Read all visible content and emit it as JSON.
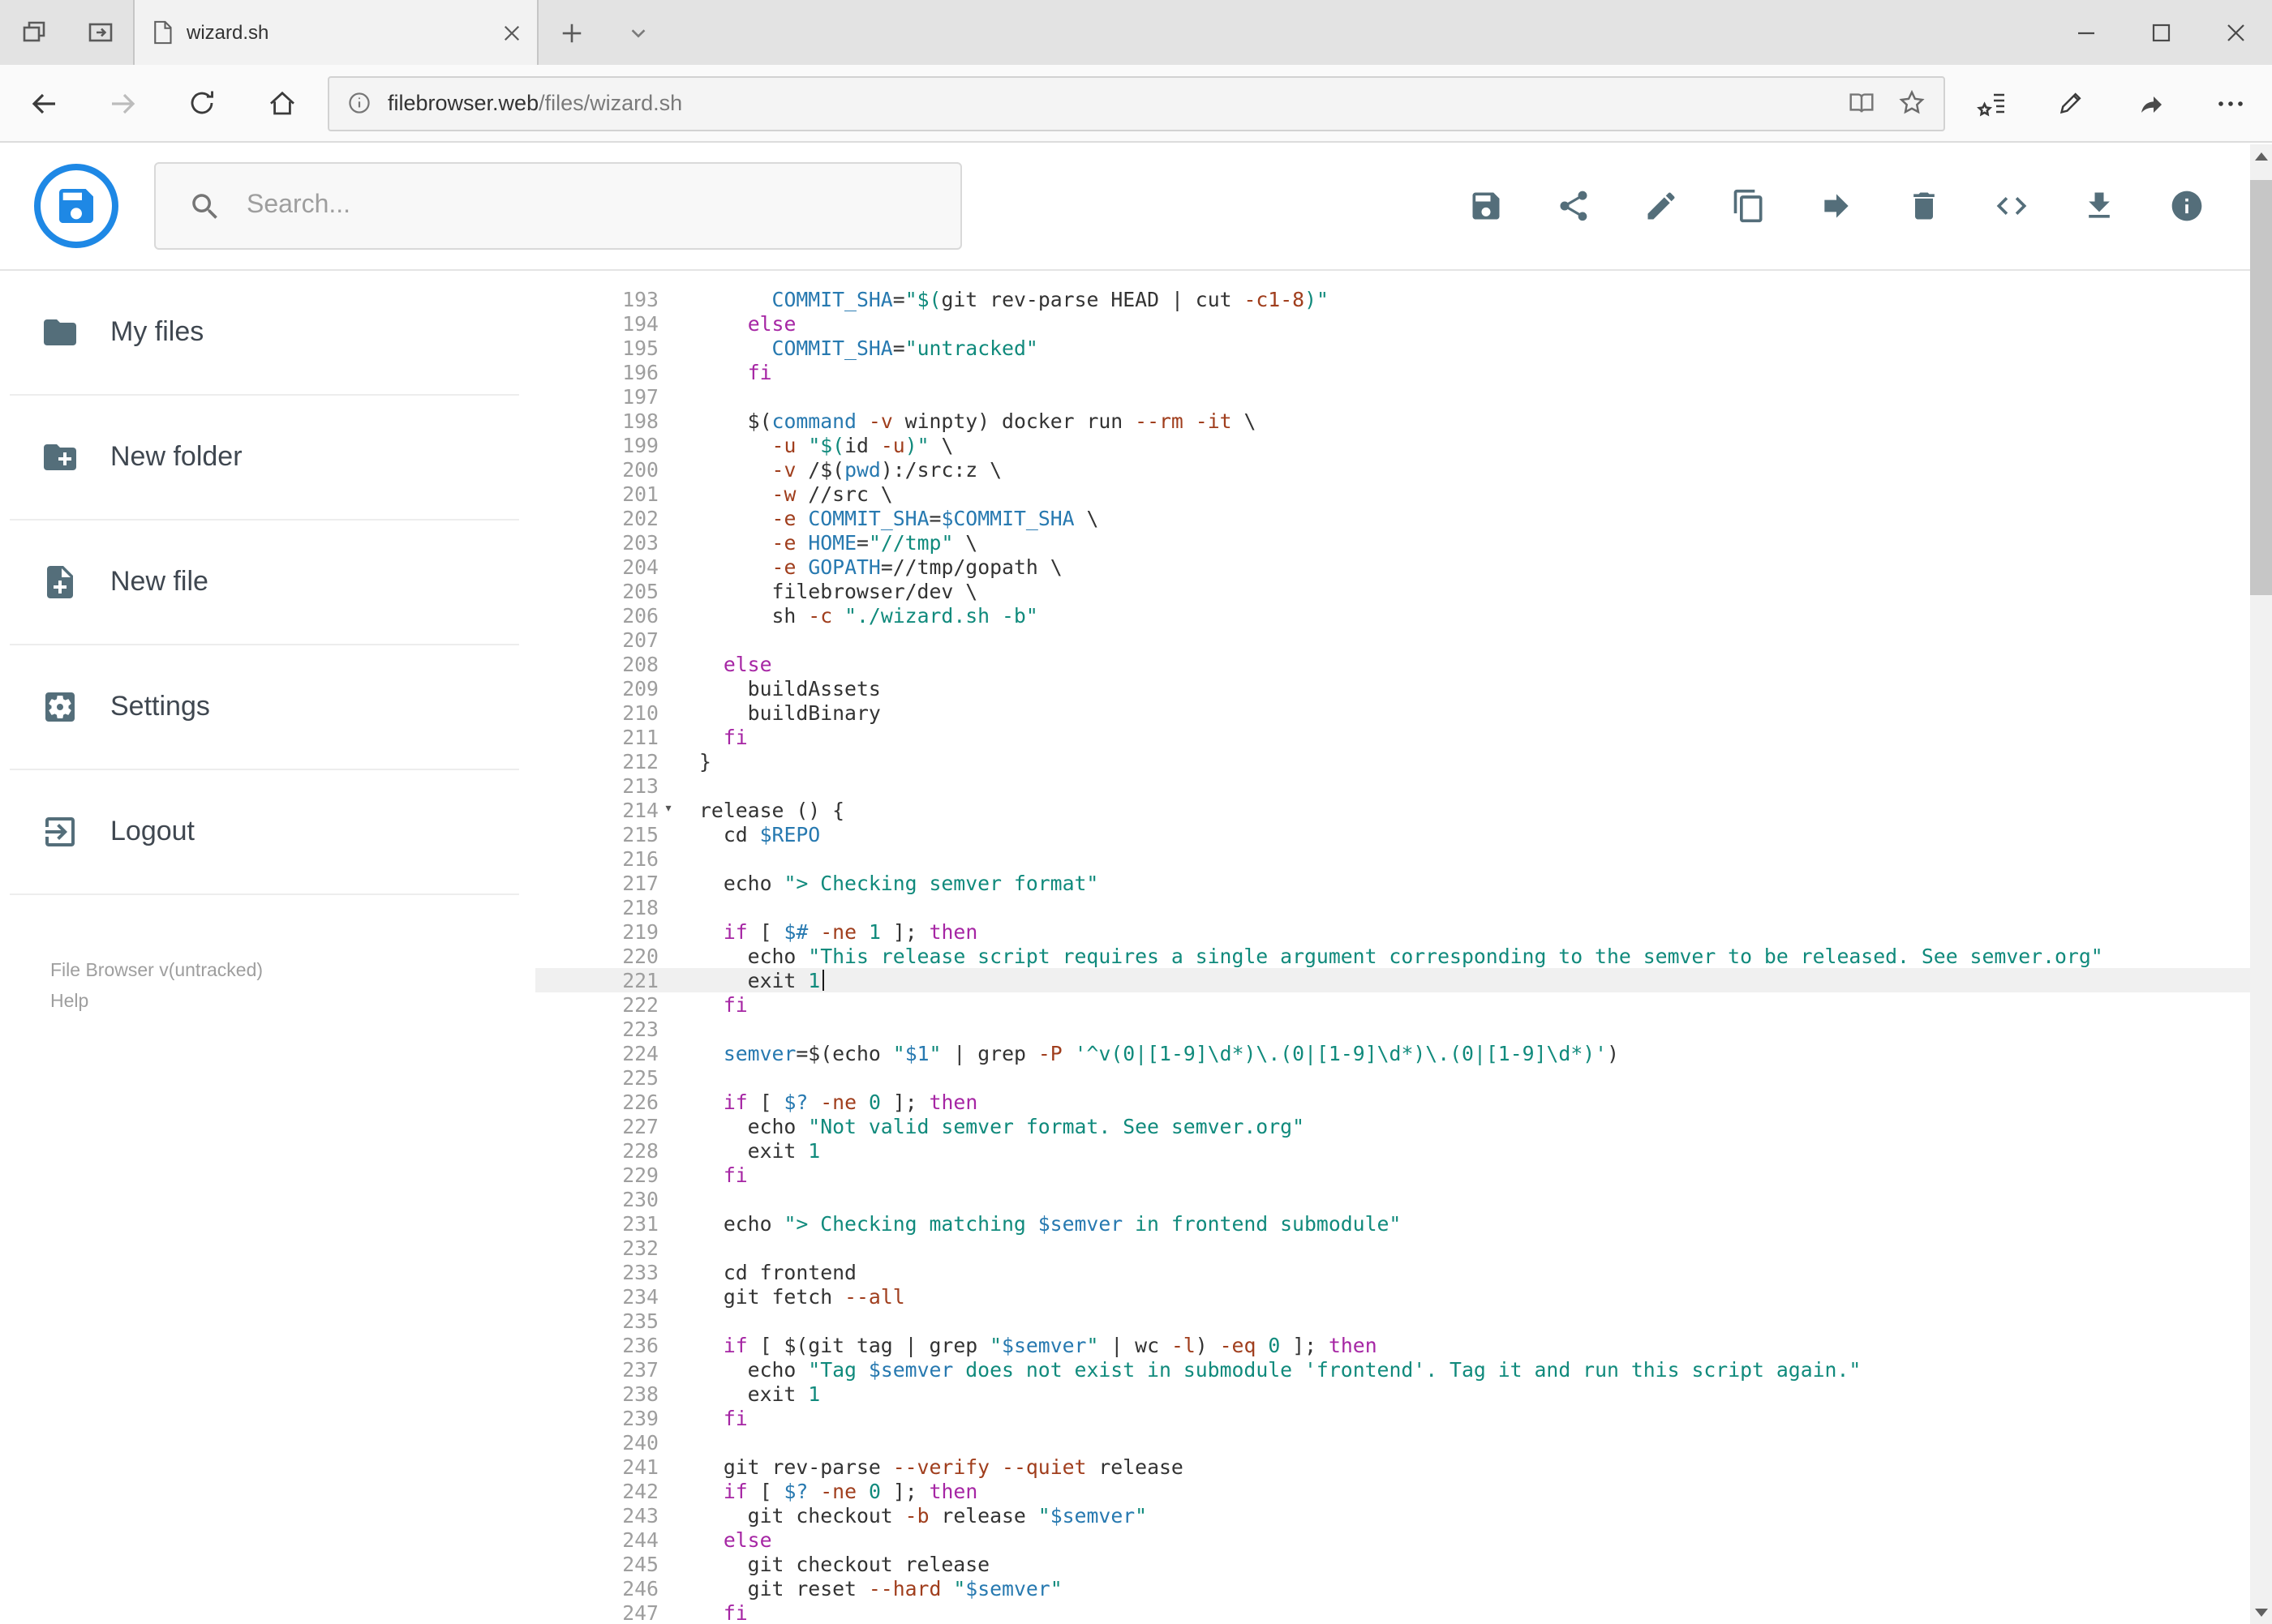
{
  "browser": {
    "tab_title": "wizard.sh",
    "url_host": "filebrowser.web",
    "url_path": "/files/wizard.sh"
  },
  "header": {
    "search_placeholder": "Search...",
    "toolbar": [
      {
        "id": "save",
        "icon": "save"
      },
      {
        "id": "share",
        "icon": "share"
      },
      {
        "id": "edit",
        "icon": "edit"
      },
      {
        "id": "copy",
        "icon": "copy"
      },
      {
        "id": "move",
        "icon": "move"
      },
      {
        "id": "delete",
        "icon": "delete"
      },
      {
        "id": "code",
        "icon": "code"
      },
      {
        "id": "download",
        "icon": "download"
      },
      {
        "id": "info",
        "icon": "info"
      }
    ]
  },
  "sidebar": {
    "items": [
      {
        "id": "my-files",
        "label": "My files",
        "icon": "folder"
      },
      {
        "id": "new-folder",
        "label": "New folder",
        "icon": "create-new-folder"
      },
      {
        "id": "new-file",
        "label": "New file",
        "icon": "note-add"
      },
      {
        "id": "settings",
        "label": "Settings",
        "icon": "settings"
      },
      {
        "id": "logout",
        "label": "Logout",
        "icon": "logout"
      }
    ],
    "footer_version": "File Browser v(untracked)",
    "footer_help": "Help"
  },
  "editor": {
    "active_line": 221,
    "lines": [
      {
        "n": 193,
        "t": [
          [
            "p",
            "      "
          ],
          [
            "v",
            "COMMIT_SHA"
          ],
          [
            "p",
            "="
          ],
          [
            "s",
            "\"$("
          ],
          [
            "p",
            "git rev-parse HEAD | cut "
          ],
          [
            "f",
            "-c1-8"
          ],
          [
            "s",
            ")\""
          ]
        ]
      },
      {
        "n": 194,
        "t": [
          [
            "p",
            "    "
          ],
          [
            "k",
            "else"
          ]
        ]
      },
      {
        "n": 195,
        "t": [
          [
            "p",
            "      "
          ],
          [
            "v",
            "COMMIT_SHA"
          ],
          [
            "p",
            "="
          ],
          [
            "s",
            "\"untracked\""
          ]
        ]
      },
      {
        "n": 196,
        "t": [
          [
            "p",
            "    "
          ],
          [
            "k",
            "fi"
          ]
        ]
      },
      {
        "n": 197,
        "t": []
      },
      {
        "n": 198,
        "t": [
          [
            "p",
            "    $("
          ],
          [
            "v",
            "command"
          ],
          [
            "p",
            " "
          ],
          [
            "f",
            "-v"
          ],
          [
            "p",
            " winpty) docker run "
          ],
          [
            "f",
            "--rm"
          ],
          [
            "p",
            " "
          ],
          [
            "f",
            "-it"
          ],
          [
            "p",
            " \\"
          ]
        ]
      },
      {
        "n": 199,
        "t": [
          [
            "p",
            "      "
          ],
          [
            "f",
            "-u"
          ],
          [
            "p",
            " "
          ],
          [
            "s",
            "\"$("
          ],
          [
            "p",
            "id "
          ],
          [
            "f",
            "-u"
          ],
          [
            "s",
            ")\""
          ],
          [
            "p",
            " \\"
          ]
        ]
      },
      {
        "n": 200,
        "t": [
          [
            "p",
            "      "
          ],
          [
            "f",
            "-v"
          ],
          [
            "p",
            " /$("
          ],
          [
            "v",
            "pwd"
          ],
          [
            "p",
            "):/src:z \\"
          ]
        ]
      },
      {
        "n": 201,
        "t": [
          [
            "p",
            "      "
          ],
          [
            "f",
            "-w"
          ],
          [
            "p",
            " //src \\"
          ]
        ]
      },
      {
        "n": 202,
        "t": [
          [
            "p",
            "      "
          ],
          [
            "f",
            "-e"
          ],
          [
            "p",
            " "
          ],
          [
            "v",
            "COMMIT_SHA"
          ],
          [
            "p",
            "="
          ],
          [
            "v",
            "$COMMIT_SHA"
          ],
          [
            "p",
            " \\"
          ]
        ]
      },
      {
        "n": 203,
        "t": [
          [
            "p",
            "      "
          ],
          [
            "f",
            "-e"
          ],
          [
            "p",
            " "
          ],
          [
            "v",
            "HOME"
          ],
          [
            "p",
            "="
          ],
          [
            "s",
            "\"//tmp\""
          ],
          [
            "p",
            " \\"
          ]
        ]
      },
      {
        "n": 204,
        "t": [
          [
            "p",
            "      "
          ],
          [
            "f",
            "-e"
          ],
          [
            "p",
            " "
          ],
          [
            "v",
            "GOPATH"
          ],
          [
            "p",
            "=//tmp/gopath \\"
          ]
        ]
      },
      {
        "n": 205,
        "t": [
          [
            "p",
            "      filebrowser/dev \\"
          ]
        ]
      },
      {
        "n": 206,
        "t": [
          [
            "p",
            "      sh "
          ],
          [
            "f",
            "-c"
          ],
          [
            "p",
            " "
          ],
          [
            "s",
            "\"./wizard.sh -b\""
          ]
        ]
      },
      {
        "n": 207,
        "t": []
      },
      {
        "n": 208,
        "t": [
          [
            "p",
            "  "
          ],
          [
            "k",
            "else"
          ]
        ]
      },
      {
        "n": 209,
        "t": [
          [
            "p",
            "    buildAssets"
          ]
        ]
      },
      {
        "n": 210,
        "t": [
          [
            "p",
            "    buildBinary"
          ]
        ]
      },
      {
        "n": 211,
        "t": [
          [
            "p",
            "  "
          ],
          [
            "k",
            "fi"
          ]
        ]
      },
      {
        "n": 212,
        "t": [
          [
            "p",
            "}"
          ]
        ]
      },
      {
        "n": 213,
        "t": []
      },
      {
        "n": 214,
        "fold": true,
        "t": [
          [
            "p",
            "release () {"
          ]
        ]
      },
      {
        "n": 215,
        "t": [
          [
            "p",
            "  cd "
          ],
          [
            "v",
            "$REPO"
          ]
        ]
      },
      {
        "n": 216,
        "t": []
      },
      {
        "n": 217,
        "t": [
          [
            "p",
            "  echo "
          ],
          [
            "s",
            "\"> Checking semver format\""
          ]
        ]
      },
      {
        "n": 218,
        "t": []
      },
      {
        "n": 219,
        "t": [
          [
            "p",
            "  "
          ],
          [
            "k",
            "if"
          ],
          [
            "p",
            " [ "
          ],
          [
            "v",
            "$#"
          ],
          [
            "p",
            " "
          ],
          [
            "f",
            "-ne"
          ],
          [
            "p",
            " "
          ],
          [
            "d",
            "1"
          ],
          [
            "p",
            " ]; "
          ],
          [
            "k",
            "then"
          ]
        ]
      },
      {
        "n": 220,
        "t": [
          [
            "p",
            "    echo "
          ],
          [
            "s",
            "\"This release script requires a single argument corresponding to the semver to be released. See semver.org\""
          ]
        ]
      },
      {
        "n": 221,
        "t": [
          [
            "p",
            "    exit "
          ],
          [
            "d",
            "1"
          ],
          [
            "x",
            ""
          ]
        ]
      },
      {
        "n": 222,
        "t": [
          [
            "p",
            "  "
          ],
          [
            "k",
            "fi"
          ]
        ]
      },
      {
        "n": 223,
        "t": []
      },
      {
        "n": 224,
        "t": [
          [
            "p",
            "  "
          ],
          [
            "v",
            "semver"
          ],
          [
            "p",
            "=$(echo "
          ],
          [
            "s",
            "\""
          ],
          [
            "v",
            "$1"
          ],
          [
            "s",
            "\""
          ],
          [
            "p",
            " | grep "
          ],
          [
            "f",
            "-P"
          ],
          [
            "p",
            " "
          ],
          [
            "s",
            "'^v(0|[1-9]\\d*)\\.(0|[1-9]\\d*)\\.(0|[1-9]\\d*)'"
          ],
          [
            "p",
            ")"
          ]
        ]
      },
      {
        "n": 225,
        "t": []
      },
      {
        "n": 226,
        "t": [
          [
            "p",
            "  "
          ],
          [
            "k",
            "if"
          ],
          [
            "p",
            " [ "
          ],
          [
            "v",
            "$?"
          ],
          [
            "p",
            " "
          ],
          [
            "f",
            "-ne"
          ],
          [
            "p",
            " "
          ],
          [
            "d",
            "0"
          ],
          [
            "p",
            " ]; "
          ],
          [
            "k",
            "then"
          ]
        ]
      },
      {
        "n": 227,
        "t": [
          [
            "p",
            "    echo "
          ],
          [
            "s",
            "\"Not valid semver format. See semver.org\""
          ]
        ]
      },
      {
        "n": 228,
        "t": [
          [
            "p",
            "    exit "
          ],
          [
            "d",
            "1"
          ]
        ]
      },
      {
        "n": 229,
        "t": [
          [
            "p",
            "  "
          ],
          [
            "k",
            "fi"
          ]
        ]
      },
      {
        "n": 230,
        "t": []
      },
      {
        "n": 231,
        "t": [
          [
            "p",
            "  echo "
          ],
          [
            "s",
            "\"> Checking matching "
          ],
          [
            "v",
            "$semver"
          ],
          [
            "s",
            " in frontend submodule\""
          ]
        ]
      },
      {
        "n": 232,
        "t": []
      },
      {
        "n": 233,
        "t": [
          [
            "p",
            "  cd frontend"
          ]
        ]
      },
      {
        "n": 234,
        "t": [
          [
            "p",
            "  git fetch "
          ],
          [
            "f",
            "--all"
          ]
        ]
      },
      {
        "n": 235,
        "t": []
      },
      {
        "n": 236,
        "t": [
          [
            "p",
            "  "
          ],
          [
            "k",
            "if"
          ],
          [
            "p",
            " [ $(git tag | grep "
          ],
          [
            "s",
            "\""
          ],
          [
            "v",
            "$semver"
          ],
          [
            "s",
            "\""
          ],
          [
            "p",
            " | wc "
          ],
          [
            "f",
            "-l"
          ],
          [
            "p",
            ") "
          ],
          [
            "f",
            "-eq"
          ],
          [
            "p",
            " "
          ],
          [
            "d",
            "0"
          ],
          [
            "p",
            " ]; "
          ],
          [
            "k",
            "then"
          ]
        ]
      },
      {
        "n": 237,
        "t": [
          [
            "p",
            "    echo "
          ],
          [
            "s",
            "\"Tag "
          ],
          [
            "v",
            "$semver"
          ],
          [
            "s",
            " does not exist in submodule 'frontend'. Tag it and run this script again.\""
          ]
        ]
      },
      {
        "n": 238,
        "t": [
          [
            "p",
            "    exit "
          ],
          [
            "d",
            "1"
          ]
        ]
      },
      {
        "n": 239,
        "t": [
          [
            "p",
            "  "
          ],
          [
            "k",
            "fi"
          ]
        ]
      },
      {
        "n": 240,
        "t": []
      },
      {
        "n": 241,
        "t": [
          [
            "p",
            "  git rev-parse "
          ],
          [
            "f",
            "--verify"
          ],
          [
            "p",
            " "
          ],
          [
            "f",
            "--quiet"
          ],
          [
            "p",
            " release"
          ]
        ]
      },
      {
        "n": 242,
        "t": [
          [
            "p",
            "  "
          ],
          [
            "k",
            "if"
          ],
          [
            "p",
            " [ "
          ],
          [
            "v",
            "$?"
          ],
          [
            "p",
            " "
          ],
          [
            "f",
            "-ne"
          ],
          [
            "p",
            " "
          ],
          [
            "d",
            "0"
          ],
          [
            "p",
            " ]; "
          ],
          [
            "k",
            "then"
          ]
        ]
      },
      {
        "n": 243,
        "t": [
          [
            "p",
            "    git checkout "
          ],
          [
            "f",
            "-b"
          ],
          [
            "p",
            " release "
          ],
          [
            "s",
            "\""
          ],
          [
            "v",
            "$semver"
          ],
          [
            "s",
            "\""
          ]
        ]
      },
      {
        "n": 244,
        "t": [
          [
            "p",
            "  "
          ],
          [
            "k",
            "else"
          ]
        ]
      },
      {
        "n": 245,
        "t": [
          [
            "p",
            "    git checkout release"
          ]
        ]
      },
      {
        "n": 246,
        "t": [
          [
            "p",
            "    git reset "
          ],
          [
            "f",
            "--hard"
          ],
          [
            "p",
            " "
          ],
          [
            "s",
            "\""
          ],
          [
            "v",
            "$semver"
          ],
          [
            "s",
            "\""
          ]
        ]
      },
      {
        "n": 247,
        "t": [
          [
            "p",
            "  "
          ],
          [
            "k",
            "fi"
          ]
        ]
      }
    ]
  }
}
